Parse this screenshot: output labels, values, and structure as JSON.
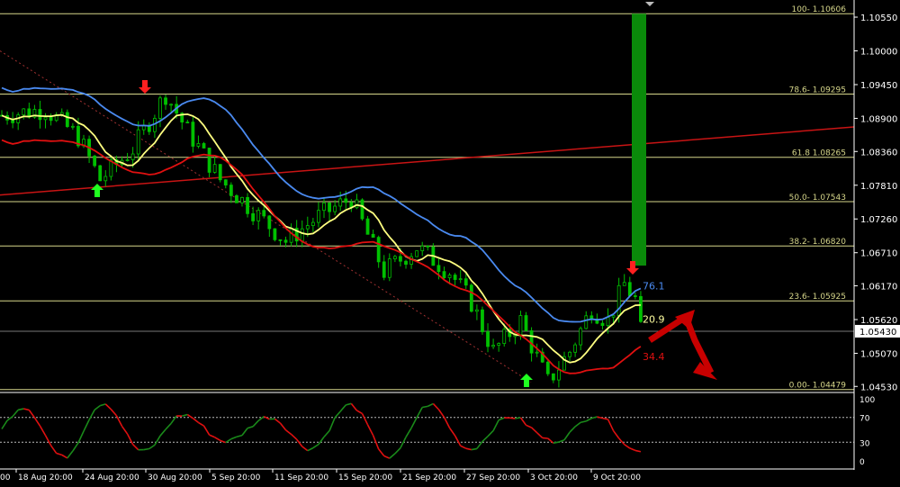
{
  "chart_data": {
    "type": "candlestick-trading-chart",
    "symbol_context": "EURUSD-like forex daily/4h chart",
    "price_axis": {
      "ylim": [
        1.0449,
        1.108
      ],
      "tick_labels": [
        "1.10550",
        "1.10000",
        "1.09450",
        "1.08900",
        "1.08360",
        "1.07810",
        "1.07260",
        "1.06710",
        "1.06170",
        "1.05620",
        "1.05070",
        "1.04530"
      ],
      "tick_values": [
        1.1055,
        1.1,
        1.0945,
        1.089,
        1.0836,
        1.0781,
        1.0726,
        1.0671,
        1.0617,
        1.0562,
        1.0507,
        1.0453
      ],
      "current_price_label": "1.05430",
      "current_price": 1.0543
    },
    "time_axis": {
      "labels": [
        "18 Aug 20:00",
        "24 Aug 20:00",
        "30 Aug 20:00",
        "5 Sep 20:00",
        "11 Sep 20:00",
        "15 Sep 20:00",
        "21 Sep 20:00",
        "27 Sep 20:00",
        "3 Oct 20:00",
        "9 Oct 20:00"
      ],
      "left_partial_label": "00"
    },
    "fibonacci_levels": [
      {
        "label": "100- 1.10606",
        "price": 1.10606
      },
      {
        "label": "78.6- 1.09295",
        "price": 1.09295
      },
      {
        "label": "61.8 1.08265",
        "price": 1.08265
      },
      {
        "label": "50.0- 1.07543",
        "price": 1.07543
      },
      {
        "label": "38.2- 1.06820",
        "price": 1.0682
      },
      {
        "label": "23.6- 1.05925",
        "price": 1.05925
      },
      {
        "label": "0.00- 1.04479",
        "price": 1.04479
      }
    ],
    "fib_color": "#d6d68a",
    "series": [
      {
        "name": "price",
        "color": "#00c000",
        "style": "candles"
      },
      {
        "name": "fast-ma",
        "color": "#ffff80"
      },
      {
        "name": "blue-ma",
        "color": "#4a8af0"
      },
      {
        "name": "red-ma",
        "color": "#e01010"
      }
    ],
    "ma_value_labels": [
      {
        "text": "76.1",
        "color": "#4a8af0"
      },
      {
        "text": "20.9",
        "color": "#ffffa0"
      },
      {
        "text": "34.4",
        "color": "#e01010"
      }
    ],
    "signal_arrows": [
      {
        "kind": "down",
        "color": "#ff2020"
      },
      {
        "kind": "up",
        "color": "#20ff20"
      },
      {
        "kind": "up",
        "color": "#20ff20"
      },
      {
        "kind": "down",
        "color": "#ff2020"
      }
    ],
    "oscillator": {
      "levels": [
        "100",
        "70",
        "30",
        "0"
      ],
      "level_values": [
        100,
        70,
        30,
        0
      ],
      "up_color": "#1a8a1a",
      "down_color": "#e01010"
    },
    "colors": {
      "background": "#000000",
      "grid": "#ffffff",
      "green_bar": "#0a8a0a",
      "trendline": "#c81414"
    }
  }
}
